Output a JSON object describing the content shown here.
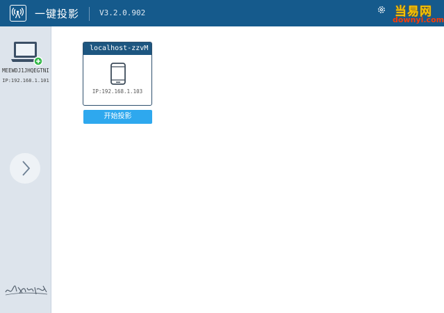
{
  "header": {
    "app_icon": "projection-icon",
    "title": "一键投影",
    "version": "V3.2.0.902",
    "settings_icon": "gear-icon"
  },
  "watermark": {
    "top": "当易网",
    "bottom": "downyi.com"
  },
  "sidebar": {
    "host_icon": "laptop-icon",
    "host_name": "MEEWDJ1JHQEGTNI",
    "host_ip": "IP:192.168.1.101",
    "next_icon": "chevron-right-icon",
    "signature_text": "让投影更简单"
  },
  "devices": [
    {
      "name": "localhost-zzvM",
      "icon": "phone-icon",
      "ip": "IP:192.168.1.103",
      "action_label": "开始投影"
    }
  ],
  "colors": {
    "titlebar": "#155a8c",
    "sidebar": "#dde4ec",
    "card_header": "#1d5680",
    "action_button": "#2ea8ee",
    "add_badge": "#35b84a"
  }
}
